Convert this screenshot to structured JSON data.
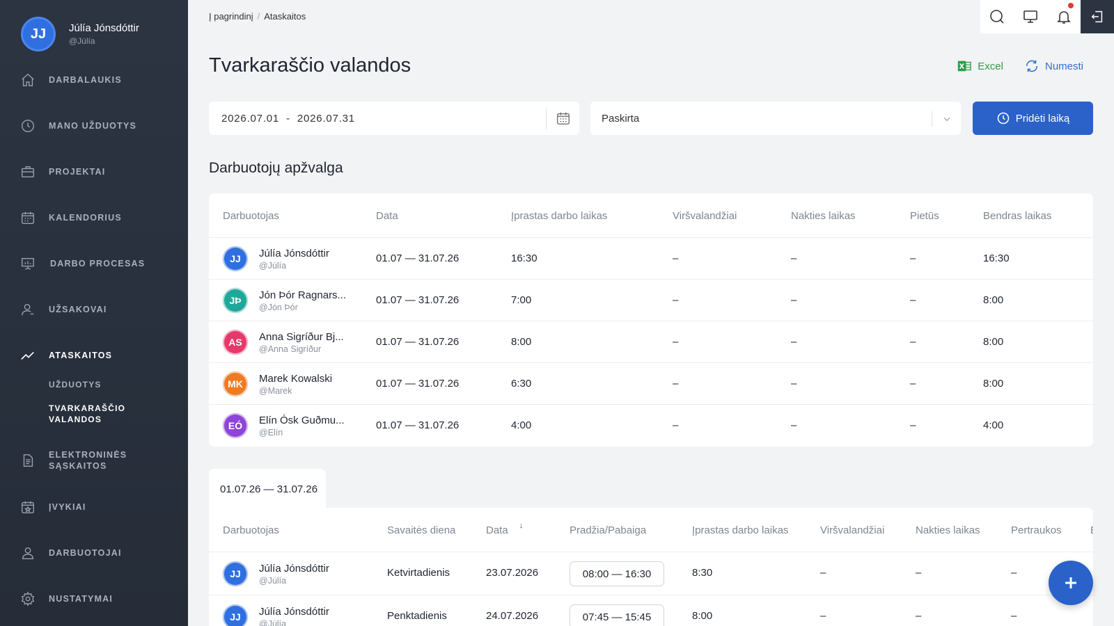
{
  "user": {
    "initials": "JJ",
    "name": "Júlía Jónsdóttir",
    "handle": "@Júlía"
  },
  "nav": {
    "dashboard": "DARBALAUKIS",
    "my_tasks": "MANO UŽDUOTYS",
    "projects": "PROJEKTAI",
    "calendar": "KALENDORIUS",
    "workflow": "DARBO PROCESAS",
    "clients": "UŽSAKOVAI",
    "reports": "ATASKAITOS",
    "reports_tasks": "UŽDUOTYS",
    "reports_timesheet_1": "TVARKARAŠČIO",
    "reports_timesheet_2": "VALANDOS",
    "invoices_1": "ELEKTRONINĖS",
    "invoices_2": "SĄSKAITOS",
    "events": "ĮVYKIAI",
    "employees": "DARBUOTOJAI",
    "settings": "NUSTATYMAI"
  },
  "breadcrumb": {
    "home": "Į pagrindinį",
    "current": "Ataskaitos"
  },
  "page": {
    "title": "Tvarkaraščio valandos"
  },
  "actions": {
    "excel": "Excel",
    "reset": "Numesti"
  },
  "filters": {
    "date_from": "2026.07.01",
    "date_sep": "-",
    "date_to": "2026.07.31",
    "assigned": "Paskirta",
    "add_time": "Pridėti laiką"
  },
  "overview": {
    "title": "Darbuotojų apžvalga",
    "columns": [
      "Darbuotojas",
      "Data",
      "Įprastas darbo laikas",
      "Viršvalandžiai",
      "Nakties laikas",
      "Pietūs",
      "Bendras laikas"
    ],
    "rows": [
      {
        "initials": "JJ",
        "color": "#2f6fe0",
        "name": "Júlía Jónsdóttir",
        "handle": "@Júlía",
        "date": "01.07 — 31.07.26",
        "regular": "16:30",
        "overtime": "–",
        "night": "–",
        "lunch": "–",
        "total": "16:30"
      },
      {
        "initials": "JÞ",
        "color": "#1fa89a",
        "name": "Jón Þór Ragnars...",
        "handle": "@Jón Þór",
        "date": "01.07 — 31.07.26",
        "regular": "7:00",
        "overtime": "–",
        "night": "–",
        "lunch": "–",
        "total": "8:00"
      },
      {
        "initials": "AS",
        "color": "#e8386a",
        "name": "Anna Sigríður Bj...",
        "handle": "@Anna Sigríður",
        "date": "01.07 — 31.07.26",
        "regular": "8:00",
        "overtime": "–",
        "night": "–",
        "lunch": "–",
        "total": "8:00"
      },
      {
        "initials": "MK",
        "color": "#f07a22",
        "name": "Marek Kowalski",
        "handle": "@Marek",
        "date": "01.07 — 31.07.26",
        "regular": "6:30",
        "overtime": "–",
        "night": "–",
        "lunch": "–",
        "total": "8:00"
      },
      {
        "initials": "EÓ",
        "color": "#8e44d8",
        "name": "Elín Ósk Guðmu...",
        "handle": "@Elín",
        "date": "01.07 — 31.07.26",
        "regular": "4:00",
        "overtime": "–",
        "night": "–",
        "lunch": "–",
        "total": "4:00"
      }
    ]
  },
  "details": {
    "tab": "01.07.26 — 31.07.26",
    "columns": [
      "Darbuotojas",
      "Savaitės diena",
      "Data",
      "Pradžia/Pabaiga",
      "Įprastas darbo laikas",
      "Viršvalandžiai",
      "Nakties laikas",
      "Pertraukos",
      "E"
    ],
    "sort_arrow": "↓",
    "rows": [
      {
        "initials": "JJ",
        "color": "#2f6fe0",
        "name": "Júlía Jónsdóttir",
        "handle": "@Júlía",
        "weekday": "Ketvirtadienis",
        "date": "23.07.2026",
        "range": "08:00 — 16:30",
        "regular": "8:30",
        "overtime": "–",
        "night": "–",
        "breaks": "–"
      },
      {
        "initials": "JJ",
        "color": "#2f6fe0",
        "name": "Júlía Jónsdóttir",
        "handle": "@Júlía",
        "weekday": "Penktadienis",
        "date": "24.07.2026",
        "range": "07:45 — 15:45",
        "regular": "8:00",
        "overtime": "–",
        "night": "–",
        "breaks": "–"
      }
    ]
  }
}
